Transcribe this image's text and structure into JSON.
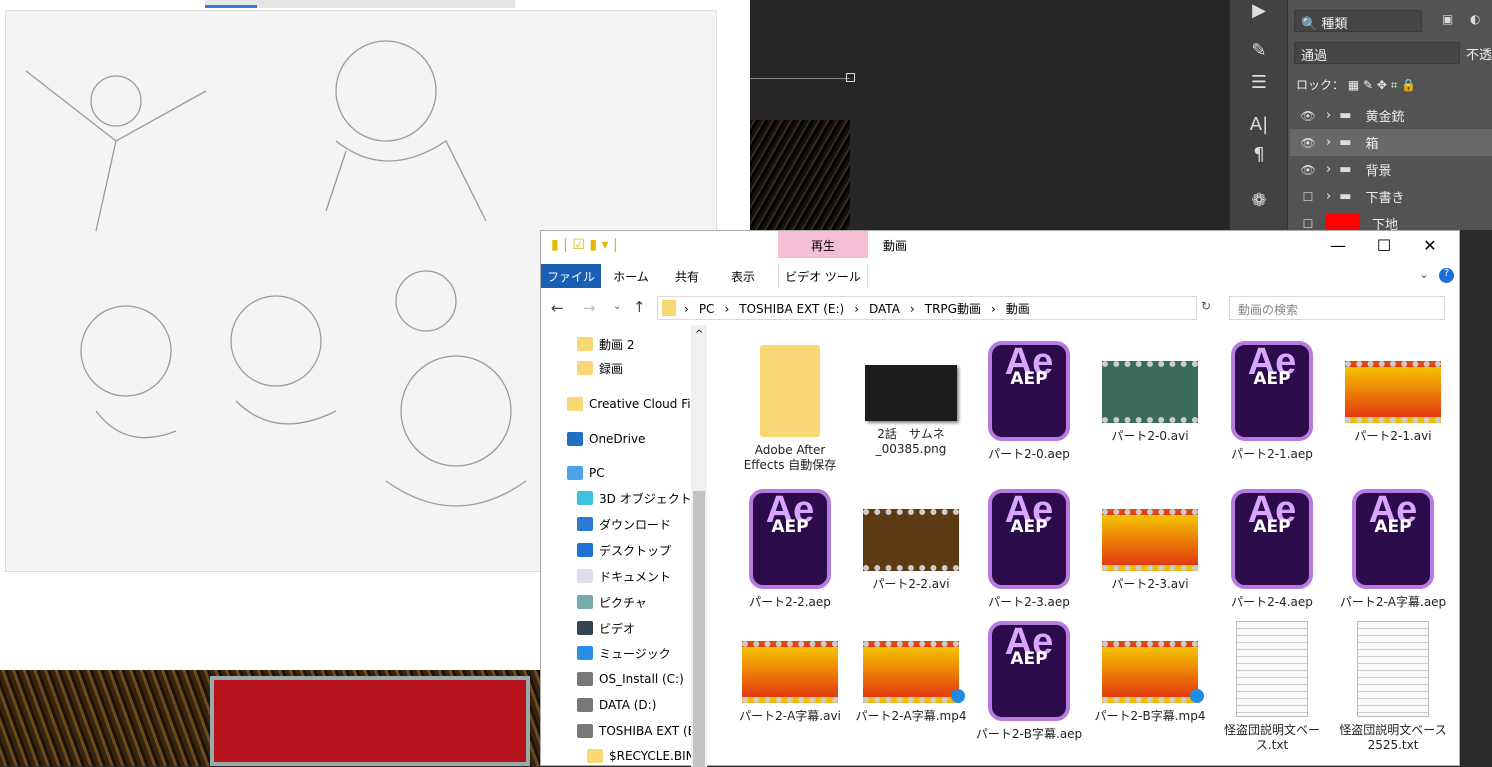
{
  "photoshop": {
    "filter_label": "種類",
    "blend_mode": "通過",
    "opacity_label": "不透",
    "lock_label": "ロック：",
    "layers": [
      {
        "name": "黄金銃",
        "visible": true
      },
      {
        "name": "箱",
        "visible": true,
        "selected": true
      },
      {
        "name": "背景",
        "visible": true
      },
      {
        "name": "下書き",
        "visible": false
      },
      {
        "name": "下地",
        "visible": false,
        "color": "#ff0000"
      }
    ]
  },
  "explorer": {
    "context_tab": "再生",
    "title": "動画",
    "ribbon_tabs": [
      "ファイル",
      "ホーム",
      "共有",
      "表示",
      "ビデオ ツール"
    ],
    "window_controls": {
      "minimize": "—",
      "maximize": "☐",
      "close": "✕"
    },
    "breadcrumb": [
      "PC",
      "TOSHIBA EXT (E:)",
      "DATA",
      "TRPG動画",
      "動画"
    ],
    "search_placeholder": "動画の検索",
    "nav": [
      {
        "label": "動画 2",
        "icon": "folder-icon"
      },
      {
        "label": "録画",
        "icon": "folder-icon"
      },
      {
        "label": "Creative Cloud Files",
        "icon": "creative-cloud-icon"
      },
      {
        "label": "OneDrive",
        "icon": "onedrive-icon"
      },
      {
        "label": "PC",
        "icon": "pc-icon"
      },
      {
        "label": "3D オブジェクト",
        "icon": "3d-objects-icon"
      },
      {
        "label": "ダウンロード",
        "icon": "download-icon"
      },
      {
        "label": "デスクトップ",
        "icon": "desktop-icon"
      },
      {
        "label": "ドキュメント",
        "icon": "documents-icon"
      },
      {
        "label": "ピクチャ",
        "icon": "pictures-icon"
      },
      {
        "label": "ビデオ",
        "icon": "videos-icon"
      },
      {
        "label": "ミュージック",
        "icon": "music-icon"
      },
      {
        "label": "OS_Install (C:)",
        "icon": "drive-icon"
      },
      {
        "label": "DATA (D:)",
        "icon": "drive-icon"
      },
      {
        "label": "TOSHIBA EXT (E:)",
        "icon": "drive-icon"
      },
      {
        "label": "$RECYCLE.BIN",
        "icon": "folder-icon"
      }
    ],
    "files": [
      {
        "name": "Adobe After Effects 自動保存",
        "type": "folder"
      },
      {
        "name": "2話　サムネ_00385.png",
        "type": "png"
      },
      {
        "name": "パート2-0.aep",
        "type": "aep"
      },
      {
        "name": "パート2-0.avi",
        "type": "avi",
        "thumb": "g"
      },
      {
        "name": "パート2-1.aep",
        "type": "aep"
      },
      {
        "name": "パート2-1.avi",
        "type": "avi",
        "thumb": "y"
      },
      {
        "name": "パート2-2.aep",
        "type": "aep"
      },
      {
        "name": "パート2-2.avi",
        "type": "avi",
        "thumb": "b"
      },
      {
        "name": "パート2-3.aep",
        "type": "aep"
      },
      {
        "name": "パート2-3.avi",
        "type": "avi",
        "thumb": "y"
      },
      {
        "name": "パート2-4.aep",
        "type": "aep"
      },
      {
        "name": "パート2-A字幕.aep",
        "type": "aep"
      },
      {
        "name": "パート2-A字幕.avi",
        "type": "avi",
        "thumb": "y"
      },
      {
        "name": "パート2-A字幕.mp4",
        "type": "mp4",
        "thumb": "y"
      },
      {
        "name": "パート2-B字幕.aep",
        "type": "aep"
      },
      {
        "name": "パート2-B字幕.mp4",
        "type": "mp4",
        "thumb": "y"
      },
      {
        "name": "怪盗団説明文ベース.txt",
        "type": "txt"
      },
      {
        "name": "怪盗団説明文ベース2525.txt",
        "type": "txt"
      }
    ],
    "aep_icon": {
      "big": "Ae",
      "small": "AEP"
    }
  },
  "colors": {
    "accent": "#1a5fb4",
    "context_tab": "#f7bfd6",
    "ae_purple": "#2b0b49"
  }
}
